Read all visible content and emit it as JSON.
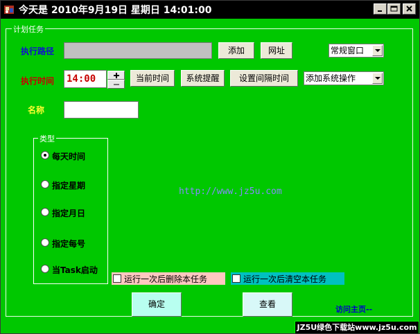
{
  "window": {
    "title": "今天是 2010年9月19日 星期日 14:01:00"
  },
  "group": {
    "legend": "计划任务"
  },
  "path_row": {
    "label": "执行路径",
    "value": "",
    "add_button": "添加",
    "url_button": "网址",
    "window_mode": "常规窗口"
  },
  "time_row": {
    "label": "执行时间",
    "time_value": "14:00",
    "spin_up": "+",
    "spin_down": "-",
    "current_time_button": "当前时间",
    "system_alert_button": "系统提醒",
    "interval_button": "设置间隔时间",
    "system_action": "添加系统操作"
  },
  "name_row": {
    "label": "名称",
    "value": ""
  },
  "type_group": {
    "legend": "类型",
    "options": [
      {
        "label": "每天时间",
        "checked": true
      },
      {
        "label": "指定星期",
        "checked": false
      },
      {
        "label": "指定月日",
        "checked": false
      },
      {
        "label": "指定每号",
        "checked": false
      },
      {
        "label": "当Task启动",
        "checked": false
      }
    ]
  },
  "url_text": "http://www.jz5u.com",
  "checkboxes": {
    "delete_after_run": "运行一次后删除本任务",
    "clear_after_run": "运行一次后清空本任务"
  },
  "buttons": {
    "confirm": "确定",
    "view": "查看"
  },
  "visit_home": "访问主页--",
  "watermark": "JZ5U绿色下载站www.jz5u.com",
  "colors": {
    "background": "#00c800",
    "titlebar": "#000000",
    "delete_chk_bg": "#ffc8c0",
    "clear_chk_bg": "#00c0c0",
    "confirm_bg": "#b8fff0",
    "view_bg": "#d8f8f8"
  }
}
